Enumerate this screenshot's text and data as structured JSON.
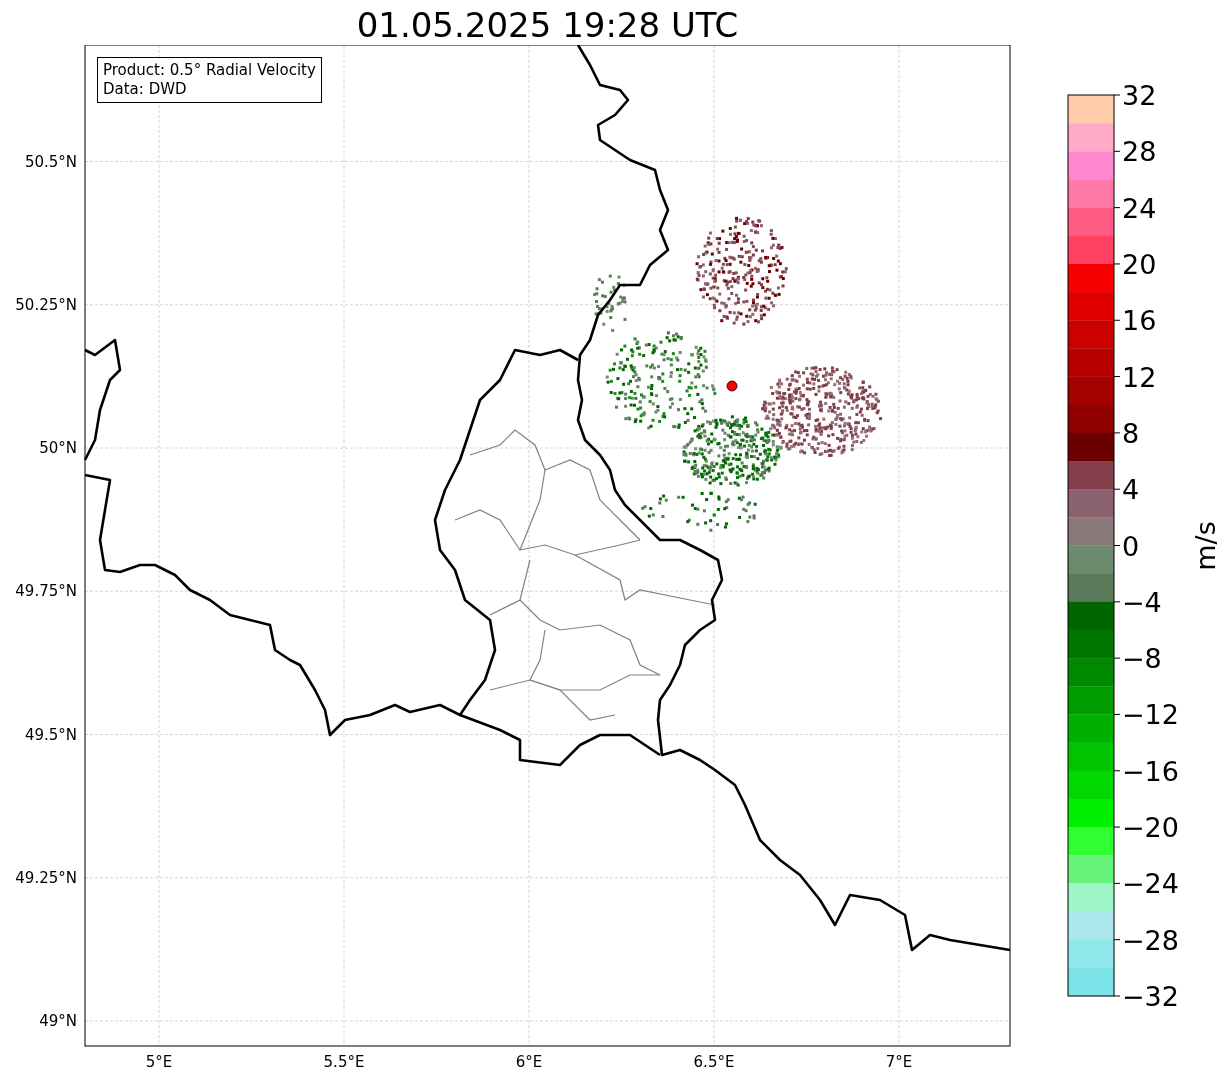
{
  "title": "01.05.2025 19:28 UTC",
  "info_box": [
    "Product: 0.5° Radial Velocity",
    "Data: DWD"
  ],
  "y_ticks": [
    "50.5°N",
    "50.25°N",
    "50°N",
    "49.75°N",
    "49.5°N",
    "49.25°N",
    "49°N"
  ],
  "x_ticks": [
    "5°E",
    "5.5°E",
    "6°E",
    "6.5°E",
    "7°E"
  ],
  "colorbar": {
    "label": "m/s",
    "ticks": [
      "32",
      "28",
      "24",
      "20",
      "16",
      "12",
      "8",
      "4",
      "0",
      "−4",
      "−8",
      "−12",
      "−16",
      "−20",
      "−24",
      "−28",
      "−32"
    ],
    "bands": [
      {
        "color": "#ffccaa"
      },
      {
        "color": "#ffaac8"
      },
      {
        "color": "#ff88d0"
      },
      {
        "color": "#ff78a8"
      },
      {
        "color": "#ff5a84"
      },
      {
        "color": "#ff4060"
      },
      {
        "color": "#f80000"
      },
      {
        "color": "#e00000"
      },
      {
        "color": "#cc0000"
      },
      {
        "color": "#b80000"
      },
      {
        "color": "#a40000"
      },
      {
        "color": "#900000"
      },
      {
        "color": "#6c0000"
      },
      {
        "color": "#84404a"
      },
      {
        "color": "#8a6270"
      },
      {
        "color": "#8a7878"
      },
      {
        "color": "#6c8a6c"
      },
      {
        "color": "#5a7c5a"
      },
      {
        "color": "#006600"
      },
      {
        "color": "#007600"
      },
      {
        "color": "#008800"
      },
      {
        "color": "#009c00"
      },
      {
        "color": "#00b000"
      },
      {
        "color": "#00c400"
      },
      {
        "color": "#00d800"
      },
      {
        "color": "#00f000"
      },
      {
        "color": "#30ff30"
      },
      {
        "color": "#66f37c"
      },
      {
        "color": "#9ef5c8"
      },
      {
        "color": "#aae8ee"
      },
      {
        "color": "#90e8ec"
      },
      {
        "color": "#7ae4e8"
      }
    ]
  }
}
